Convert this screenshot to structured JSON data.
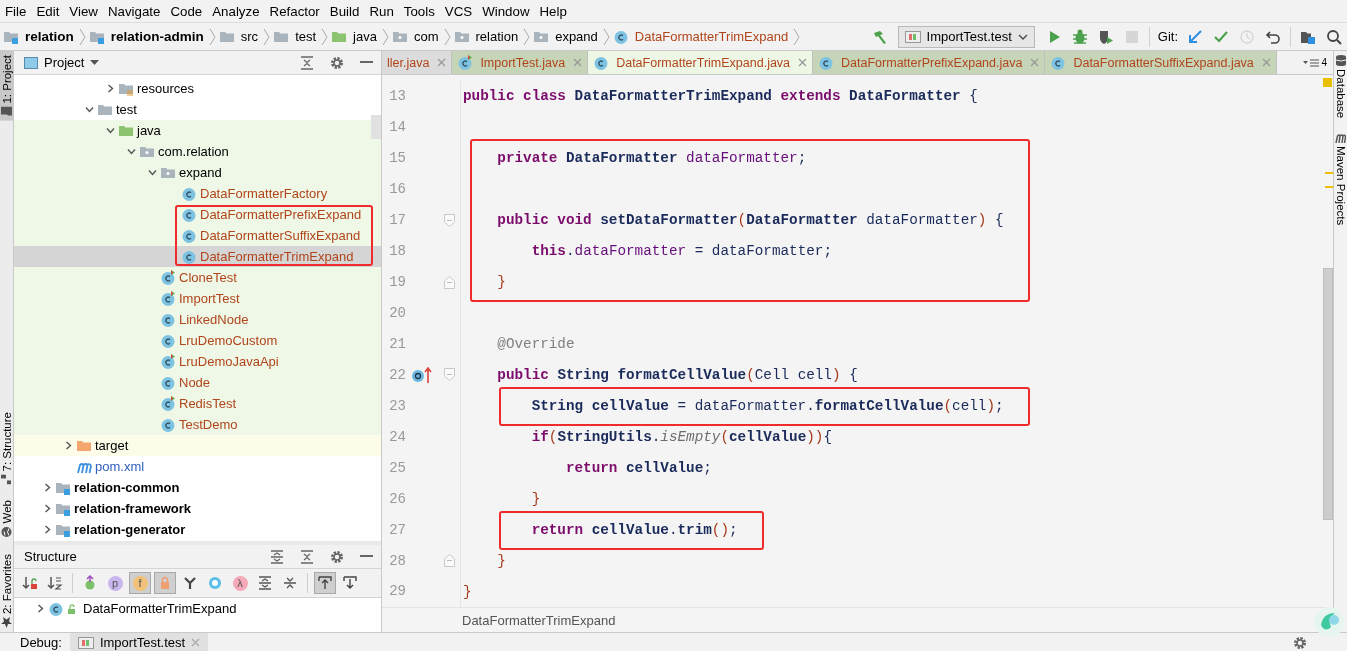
{
  "menu": [
    "File",
    "Edit",
    "View",
    "Navigate",
    "Code",
    "Analyze",
    "Refactor",
    "Build",
    "Run",
    "Tools",
    "VCS",
    "Window",
    "Help"
  ],
  "navbar": {
    "crumbs": [
      {
        "label": "relation",
        "kind": "module"
      },
      {
        "label": "relation-admin",
        "kind": "module"
      },
      {
        "label": "src",
        "kind": "folder"
      },
      {
        "label": "test",
        "kind": "folder"
      },
      {
        "label": "java",
        "kind": "test-root"
      },
      {
        "label": "com",
        "kind": "package"
      },
      {
        "label": "relation",
        "kind": "package"
      },
      {
        "label": "expand",
        "kind": "package"
      },
      {
        "label": "DataFormatterTrimExpand",
        "kind": "class"
      }
    ],
    "build_tools": [
      {
        "kind": "hammer",
        "disabled": false
      }
    ],
    "run_config": "ImportTest.test",
    "run_tools": [
      {
        "kind": "run",
        "disabled": false
      },
      {
        "kind": "debug",
        "disabled": false
      },
      {
        "kind": "coverage",
        "disabled": false
      },
      {
        "kind": "stop",
        "disabled": true
      }
    ],
    "git_label": "Git:",
    "git_tools": [
      {
        "kind": "update",
        "disabled": false
      },
      {
        "kind": "commit",
        "disabled": false
      },
      {
        "kind": "history",
        "disabled": true
      },
      {
        "kind": "revert",
        "disabled": false
      }
    ],
    "end_tools": [
      {
        "kind": "structure",
        "disabled": false
      },
      {
        "kind": "search",
        "disabled": false
      }
    ]
  },
  "left_stripe": {
    "top": [
      {
        "label": "1: Project",
        "kind": "project",
        "selected": true
      }
    ],
    "bottom": [
      {
        "label": "7: Structure",
        "kind": "structure",
        "selected": false
      },
      {
        "label": "Web",
        "kind": "web",
        "selected": false
      },
      {
        "label": "2: Favorites",
        "kind": "favorites",
        "selected": false
      }
    ]
  },
  "project_panel": {
    "title": "Project",
    "tree": [
      {
        "children": [
          {
            "children": [
              {
                "children": [
                  {
                    "label": "resources",
                    "kind": "resources",
                    "expanded": false,
                    "selected": false
                  }
                ]
              },
              {
                "label": "test",
                "kind": "folder",
                "expanded": true,
                "selected": false,
                "children": [
                  {
                    "label": "java",
                    "kind": "test-root",
                    "expanded": true,
                    "selected": false,
                    "children": [
                      {
                        "label": "com.relation",
                        "kind": "package",
                        "expanded": true,
                        "selected": false,
                        "children": [
                          {
                            "label": "expand",
                            "kind": "package",
                            "expanded": true,
                            "selected": false,
                            "children": [
                              {
                                "label": "DataFormatterFactory",
                                "kind": "class",
                                "color": "#b0451b",
                                "selected": false,
                                "boxed": false
                              },
                              {
                                "label": "DataFormatterPrefixExpand",
                                "kind": "class",
                                "color": "#b0451b",
                                "selected": false,
                                "boxed": true
                              },
                              {
                                "label": "DataFormatterSuffixExpand",
                                "kind": "class",
                                "color": "#b0451b",
                                "selected": false,
                                "boxed": true
                              },
                              {
                                "label": "DataFormatterTrimExpand",
                                "kind": "class",
                                "color": "#b0451b",
                                "selected": true,
                                "boxed": true
                              }
                            ]
                          },
                          {
                            "label": "CloneTest",
                            "kind": "test-class",
                            "color": "#b0451b",
                            "selected": false
                          },
                          {
                            "label": "ImportTest",
                            "kind": "test-class",
                            "color": "#b0451b",
                            "selected": false
                          },
                          {
                            "label": "LinkedNode",
                            "kind": "class",
                            "color": "#b0451b",
                            "selected": false
                          },
                          {
                            "label": "LruDemoCustom",
                            "kind": "class",
                            "color": "#b0451b",
                            "selected": false
                          },
                          {
                            "label": "LruDemoJavaApi",
                            "kind": "test-class",
                            "color": "#b0451b",
                            "selected": false
                          },
                          {
                            "label": "Node",
                            "kind": "class",
                            "color": "#b0451b",
                            "selected": false
                          },
                          {
                            "label": "RedisTest",
                            "kind": "test-class",
                            "color": "#b0451b",
                            "selected": false
                          },
                          {
                            "label": "TestDemo",
                            "kind": "class",
                            "color": "#b0451b",
                            "selected": false
                          }
                        ]
                      }
                    ]
                  }
                ]
              }
            ]
          },
          {
            "label": "target",
            "kind": "excluded",
            "expanded": false,
            "selected": false
          },
          {
            "label": "pom.xml",
            "kind": "maven",
            "color": "#2f5fc0",
            "selected": false
          }
        ]
      },
      {
        "label": "relation-common",
        "kind": "module",
        "expanded": false,
        "selected": false
      },
      {
        "label": "relation-framework",
        "kind": "module",
        "expanded": false,
        "selected": false
      },
      {
        "label": "relation-generator",
        "kind": "module",
        "expanded": false,
        "selected": false
      }
    ]
  },
  "structure_panel": {
    "title": "Structure",
    "toolbar_groups": [
      {
        "buttons": [
          {
            "kind": "sort-visibility",
            "on": false
          },
          {
            "kind": "sort-alpha",
            "on": false
          }
        ]
      },
      {
        "buttons": [
          {
            "kind": "inherited",
            "on": false
          },
          {
            "kind": "glyph",
            "glyph": "p",
            "color": "#c9b6ee",
            "on": false
          },
          {
            "kind": "glyph",
            "glyph": "f",
            "color": "#f2c27a",
            "on": true
          },
          {
            "kind": "lock",
            "on": true
          },
          {
            "kind": "fork",
            "on": false
          },
          {
            "kind": "ring",
            "on": false
          },
          {
            "kind": "glyph",
            "glyph": "λ",
            "color": "#f5a9b8",
            "on": false
          },
          {
            "kind": "expand",
            "on": false
          },
          {
            "kind": "collapse",
            "on": false
          }
        ]
      },
      {
        "buttons": [
          {
            "kind": "scroll-to",
            "on": true
          },
          {
            "kind": "scroll-from",
            "on": false
          }
        ]
      }
    ],
    "tree": [
      {
        "label": "DataFormatterTrimExpand",
        "expanded": false
      }
    ]
  },
  "editor": {
    "tabs": [
      {
        "label": "ller.java",
        "kind": "file",
        "selected": false
      },
      {
        "label": "ImportTest.java",
        "kind": "test-class",
        "selected": false
      },
      {
        "label": "DataFormatterTrimExpand.java",
        "kind": "class",
        "selected": true
      },
      {
        "label": "DataFormatterPrefixExpand.java",
        "kind": "class",
        "selected": false
      },
      {
        "label": "DataFormatterSuffixExpand.java",
        "kind": "class",
        "selected": false
      }
    ],
    "hidden_tab_count": "4",
    "blocks": [
      {
        "boxed": false,
        "lines": [
          {
            "number": "13",
            "kind": "plain",
            "tokens": [
              {
                "kind": "kw",
                "text": "public class "
              },
              {
                "kind": "type",
                "text": "DataFormatterTrimExpand "
              },
              {
                "kind": "kw",
                "text": "extends "
              },
              {
                "kind": "type",
                "text": "DataFormatter "
              },
              {
                "kind": "plain",
                "text": "{"
              }
            ]
          },
          {
            "number": "14",
            "kind": "plain"
          }
        ]
      },
      {
        "boxed": true,
        "lines": [
          {
            "number": "15",
            "kind": "plain",
            "tokens": [
              {
                "kind": "kw",
                "text": "    private "
              },
              {
                "kind": "type",
                "text": "DataFormatter "
              },
              {
                "kind": "field",
                "text": "dataFormatter"
              },
              {
                "kind": "plain",
                "text": ";"
              }
            ]
          },
          {
            "number": "16",
            "kind": "plain"
          },
          {
            "number": "17",
            "kind": "fold-start",
            "tokens": [
              {
                "kind": "kw",
                "text": "    public void "
              },
              {
                "kind": "method",
                "text": "setDataFormatter"
              },
              {
                "kind": "paren",
                "text": "("
              },
              {
                "kind": "type",
                "text": "DataFormatter "
              },
              {
                "kind": "plain",
                "text": "dataFormatter"
              },
              {
                "kind": "paren",
                "text": ")"
              },
              {
                "kind": "plain",
                "text": " {"
              }
            ]
          },
          {
            "number": "18",
            "kind": "plain",
            "tokens": [
              {
                "kind": "kw",
                "text": "        this"
              },
              {
                "kind": "plain",
                "text": "."
              },
              {
                "kind": "field",
                "text": "dataFormatter"
              },
              {
                "kind": "plain",
                "text": " = dataFormatter;"
              }
            ]
          },
          {
            "number": "19",
            "kind": "fold-end",
            "tokens": [
              {
                "kind": "paren",
                "text": "    }"
              }
            ]
          }
        ]
      },
      {
        "boxed": false,
        "lines": [
          {
            "number": "20",
            "kind": "plain"
          },
          {
            "number": "21",
            "kind": "plain",
            "tokens": [
              {
                "kind": "annot",
                "text": "    @Override"
              }
            ]
          },
          {
            "number": "22",
            "kind": "override",
            "tokens": [
              {
                "kind": "kw",
                "text": "    public "
              },
              {
                "kind": "type",
                "text": "String "
              },
              {
                "kind": "method",
                "text": "formatCellValue"
              },
              {
                "kind": "paren",
                "text": "("
              },
              {
                "kind": "plain",
                "text": "Cell cell"
              },
              {
                "kind": "paren",
                "text": ")"
              },
              {
                "kind": "plain",
                "text": " {"
              }
            ]
          }
        ]
      },
      {
        "boxed": true,
        "lines": [
          {
            "number": "23",
            "kind": "plain",
            "tokens": [
              {
                "kind": "type",
                "text": "        String "
              },
              {
                "kind": "ident",
                "text": "cellValue"
              },
              {
                "kind": "plain",
                "text": " = dataFormatter."
              },
              {
                "kind": "method",
                "text": "formatCellValue"
              },
              {
                "kind": "paren",
                "text": "("
              },
              {
                "kind": "plain",
                "text": "cell"
              },
              {
                "kind": "paren",
                "text": ")"
              },
              {
                "kind": "plain",
                "text": ";"
              }
            ]
          }
        ]
      },
      {
        "boxed": false,
        "lines": [
          {
            "number": "24",
            "kind": "plain",
            "tokens": [
              {
                "kind": "kw",
                "text": "        if"
              },
              {
                "kind": "paren",
                "text": "("
              },
              {
                "kind": "type",
                "text": "StringUtils"
              },
              {
                "kind": "plain",
                "text": "."
              },
              {
                "kind": "static",
                "text": "isEmpty"
              },
              {
                "kind": "paren",
                "text": "("
              },
              {
                "kind": "ident",
                "text": "cellValue"
              },
              {
                "kind": "paren",
                "text": "))"
              },
              {
                "kind": "plain",
                "text": "{"
              }
            ]
          },
          {
            "number": "25",
            "kind": "plain",
            "tokens": [
              {
                "kind": "kw",
                "text": "            return "
              },
              {
                "kind": "ident",
                "text": "cellValue"
              },
              {
                "kind": "plain",
                "text": ";"
              }
            ]
          },
          {
            "number": "26",
            "kind": "plain",
            "tokens": [
              {
                "kind": "paren",
                "text": "        }"
              }
            ]
          }
        ]
      },
      {
        "boxed": true,
        "lines": [
          {
            "number": "27",
            "kind": "plain",
            "tokens": [
              {
                "kind": "kw",
                "text": "        return "
              },
              {
                "kind": "ident",
                "text": "cellValue"
              },
              {
                "kind": "plain",
                "text": "."
              },
              {
                "kind": "method",
                "text": "trim"
              },
              {
                "kind": "paren",
                "text": "()"
              },
              {
                "kind": "plain",
                "text": ";"
              }
            ]
          }
        ]
      },
      {
        "boxed": false,
        "lines": [
          {
            "number": "28",
            "kind": "fold-end",
            "tokens": [
              {
                "kind": "paren",
                "text": "    }"
              }
            ]
          },
          {
            "number": "29",
            "kind": "plain",
            "tokens": [
              {
                "kind": "paren",
                "text": "}"
              }
            ]
          }
        ]
      }
    ],
    "footer": "DataFormatterTrimExpand"
  },
  "right_stripe": [
    {
      "label": "Database",
      "kind": "database"
    },
    {
      "label": "Maven Projects",
      "kind": "maven"
    }
  ],
  "bottom_bar": {
    "label": "Debug:",
    "tabs": [
      {
        "label": "ImportTest.test",
        "selected": true
      }
    ]
  }
}
